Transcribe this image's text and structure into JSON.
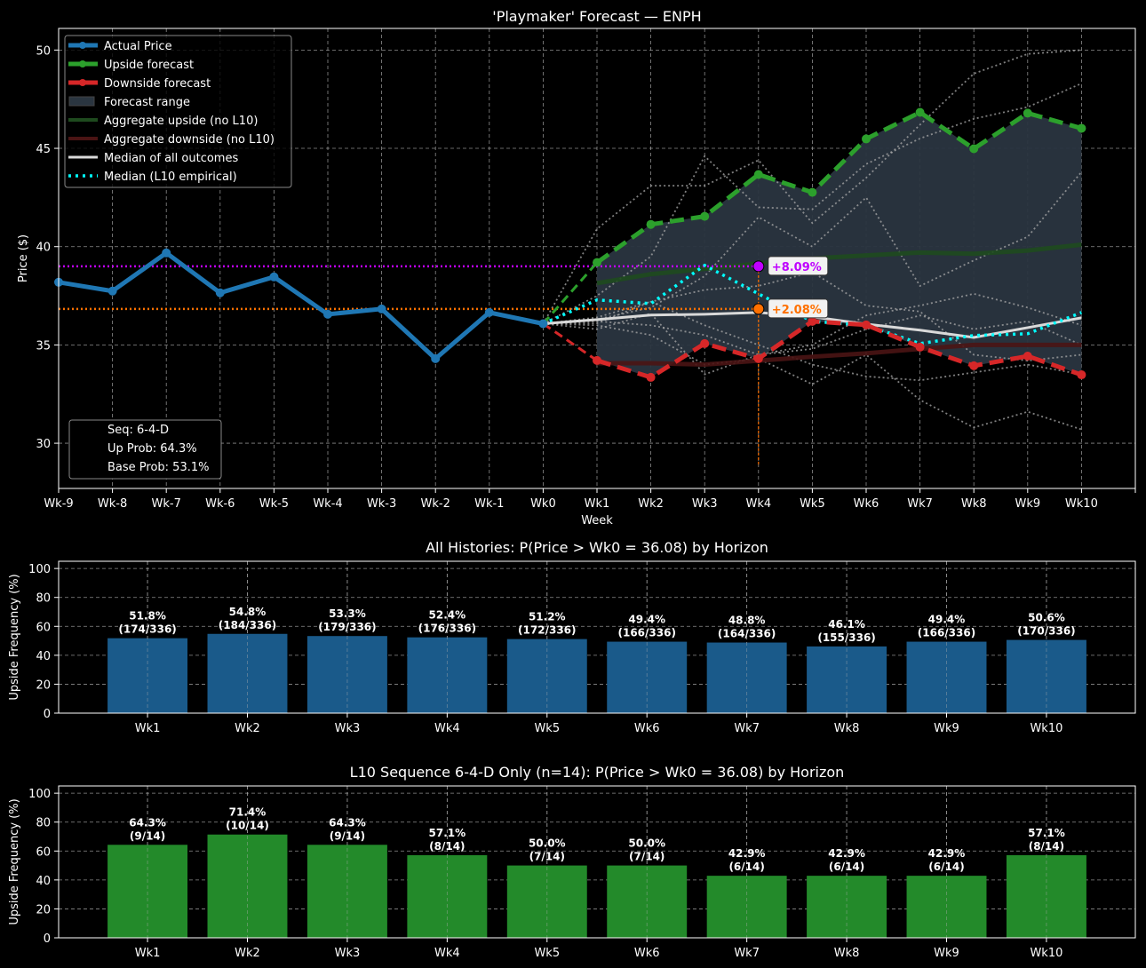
{
  "colors": {
    "background": "#000000",
    "actual": "#1f77b4",
    "upside": "#2ca02c",
    "downside": "#d62728",
    "range_fill": "#2a3540",
    "agg_up": "#1e4a1e",
    "agg_down": "#4a1414",
    "median_all": "#d9d9d9",
    "median_l10": "#00ffff",
    "purple": "#bf00ff",
    "orange": "#ff7000",
    "bar_all": "#1a5a8a",
    "bar_l10": "#238a2a",
    "grid": "#b0b0b0"
  },
  "chart_data": [
    {
      "type": "line",
      "title": "'Playmaker' Forecast — ENPH",
      "xlabel": "Week",
      "ylabel": "Price ($)",
      "xlim": [
        -9,
        11
      ],
      "ylim": [
        27.7,
        51.1
      ],
      "grid": true,
      "legend_placement": "top-left",
      "x_ticks": [
        "Wk-9",
        "Wk-8",
        "Wk-7",
        "Wk-6",
        "Wk-5",
        "Wk-4",
        "Wk-3",
        "Wk-2",
        "Wk-1",
        "Wk0",
        "Wk1",
        "Wk2",
        "Wk3",
        "Wk4",
        "Wk5",
        "Wk6",
        "Wk7",
        "Wk8",
        "Wk9",
        "Wk10"
      ],
      "y_ticks": [
        30,
        35,
        40,
        45,
        50
      ],
      "legend": [
        "Actual Price",
        "Upside forecast",
        "Downside forecast",
        "Forecast range",
        "Aggregate upside (no L10)",
        "Aggregate downside (no L10)",
        "Median of all outcomes",
        "Median (L10 empirical)"
      ],
      "actual": {
        "x": [
          -9,
          -8,
          -7,
          -6,
          -5,
          -4,
          -3,
          -2,
          -1,
          0
        ],
        "y": [
          38.19,
          37.74,
          39.68,
          37.65,
          38.46,
          36.56,
          36.83,
          34.3,
          36.65,
          36.08
        ]
      },
      "upside": {
        "x": [
          0,
          1,
          2,
          3,
          4,
          5,
          6,
          7,
          8,
          9,
          10
        ],
        "y": [
          36.08,
          39.19,
          41.13,
          41.54,
          43.67,
          42.76,
          45.48,
          46.83,
          44.98,
          46.79,
          46.02
        ]
      },
      "downside": {
        "x": [
          0,
          1,
          2,
          3,
          4,
          5,
          6,
          7,
          8,
          9,
          10
        ],
        "y": [
          36.08,
          34.21,
          33.35,
          35.07,
          34.3,
          36.2,
          36.02,
          34.89,
          33.94,
          34.43,
          33.48
        ]
      },
      "aggregate_upside": {
        "x": [
          1,
          2,
          3,
          4,
          5,
          6,
          7,
          8,
          9,
          10
        ],
        "y": [
          38.14,
          38.6,
          38.87,
          39.14,
          39.4,
          39.55,
          39.7,
          39.64,
          39.8,
          40.1
        ]
      },
      "aggregate_downside": {
        "x": [
          1,
          2,
          3,
          4,
          5,
          6,
          7,
          8,
          9,
          10
        ],
        "y": [
          34.07,
          34.07,
          34.0,
          34.2,
          34.4,
          34.57,
          34.8,
          35.0,
          35.0,
          35.0
        ]
      },
      "median_all": {
        "x": [
          0,
          1,
          2,
          3,
          4,
          5,
          6,
          7,
          8,
          9,
          10
        ],
        "y": [
          36.08,
          36.29,
          36.52,
          36.56,
          36.65,
          36.43,
          36.06,
          35.75,
          35.38,
          35.88,
          36.38
        ]
      },
      "median_l10": {
        "x": [
          0,
          1,
          2,
          3,
          4,
          5,
          6,
          7,
          8,
          9,
          10
        ],
        "y": [
          36.08,
          37.29,
          37.1,
          39.05,
          37.6,
          36.2,
          36.0,
          35.07,
          35.48,
          35.57,
          36.65
        ]
      },
      "history_paths": [
        [
          36.08,
          40.9,
          43.1,
          43.1,
          44.4,
          41.2,
          43.5,
          46.2,
          48.8,
          49.8,
          50.0
        ],
        [
          36.08,
          37.5,
          39.5,
          44.6,
          42.0,
          41.9,
          44.2,
          45.5,
          46.5,
          47.1,
          48.3
        ],
        [
          36.08,
          36.3,
          36.9,
          38.5,
          41.5,
          40.0,
          42.5,
          38.0,
          39.3,
          40.5,
          43.8
        ],
        [
          36.08,
          36.0,
          35.5,
          34.0,
          34.3,
          33.0,
          34.5,
          32.2,
          30.8,
          31.6,
          30.7
        ],
        [
          36.08,
          36.4,
          37.2,
          36.0,
          35.0,
          34.0,
          33.4,
          33.2,
          33.6,
          34.0,
          33.5
        ],
        [
          36.08,
          36.2,
          36.0,
          35.5,
          34.5,
          34.8,
          35.8,
          36.5,
          35.8,
          36.2,
          35.0
        ],
        [
          36.08,
          35.8,
          36.6,
          33.5,
          34.5,
          35.0,
          36.5,
          37.0,
          37.6,
          36.9,
          36.0
        ],
        [
          36.08,
          36.1,
          37.2,
          37.8,
          38.0,
          38.7,
          37.0,
          36.7,
          34.5,
          34.2,
          34.5
        ]
      ],
      "levels": [
        {
          "label": "+8.09%",
          "y": 39.0,
          "x": 4,
          "color": "#bf00ff"
        },
        {
          "label": "+2.08%",
          "y": 36.83,
          "x": 4,
          "color": "#ff7000"
        }
      ],
      "stats_box": {
        "seq": "Seq: 6-4-D",
        "up_prob": "Up Prob: 64.3%",
        "base_prob": "Base Prob: 53.1%"
      }
    },
    {
      "type": "bar",
      "title": "All Histories: P(Price > Wk0 = 36.08) by Horizon",
      "xlabel": "",
      "ylabel": "Upside Frequency (%)",
      "ylim": [
        0,
        105
      ],
      "y_ticks": [
        0,
        20,
        40,
        60,
        80,
        100
      ],
      "grid": true,
      "categories": [
        "Wk1",
        "Wk2",
        "Wk3",
        "Wk4",
        "Wk5",
        "Wk6",
        "Wk7",
        "Wk8",
        "Wk9",
        "Wk10"
      ],
      "values": [
        51.8,
        54.8,
        53.3,
        52.4,
        51.2,
        49.4,
        48.8,
        46.1,
        49.4,
        50.6
      ],
      "labels": [
        "51.8%",
        "54.8%",
        "53.3%",
        "52.4%",
        "51.2%",
        "49.4%",
        "48.8%",
        "46.1%",
        "49.4%",
        "50.6%"
      ],
      "counts": [
        "(174/336)",
        "(184/336)",
        "(179/336)",
        "(176/336)",
        "(172/336)",
        "(166/336)",
        "(164/336)",
        "(155/336)",
        "(166/336)",
        "(170/336)"
      ]
    },
    {
      "type": "bar",
      "title": "L10 Sequence 6-4-D Only (n=14): P(Price > Wk0 = 36.08) by Horizon",
      "xlabel": "",
      "ylabel": "Upside Frequency (%)",
      "ylim": [
        0,
        105
      ],
      "y_ticks": [
        0,
        20,
        40,
        60,
        80,
        100
      ],
      "grid": true,
      "categories": [
        "Wk1",
        "Wk2",
        "Wk3",
        "Wk4",
        "Wk5",
        "Wk6",
        "Wk7",
        "Wk8",
        "Wk9",
        "Wk10"
      ],
      "values": [
        64.3,
        71.4,
        64.3,
        57.1,
        50.0,
        50.0,
        42.9,
        42.9,
        42.9,
        57.1
      ],
      "labels": [
        "64.3%",
        "71.4%",
        "64.3%",
        "57.1%",
        "50.0%",
        "50.0%",
        "42.9%",
        "42.9%",
        "42.9%",
        "57.1%"
      ],
      "counts": [
        "(9/14)",
        "(10/14)",
        "(9/14)",
        "(8/14)",
        "(7/14)",
        "(7/14)",
        "(6/14)",
        "(6/14)",
        "(6/14)",
        "(8/14)"
      ]
    }
  ]
}
